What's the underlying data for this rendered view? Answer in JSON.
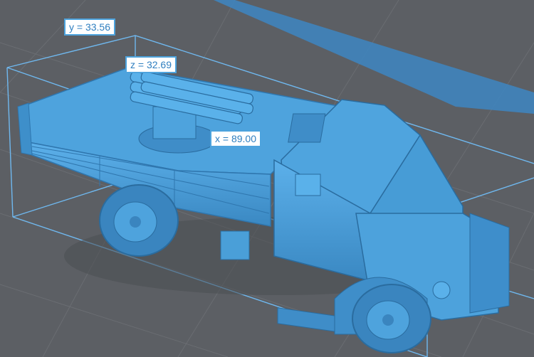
{
  "viewport": {
    "background": "#5c5f64",
    "grid_color": "#6b6e73",
    "model_color": "#4a9fd8",
    "model_dark": "#2f6f9f",
    "bbox_color": "#69b6ee",
    "model_subject": "military truck with rocket launcher"
  },
  "dimensions": {
    "y_label": "y = 33.56",
    "z_label": "z = 32.69",
    "x_label": "x = 89.00"
  }
}
